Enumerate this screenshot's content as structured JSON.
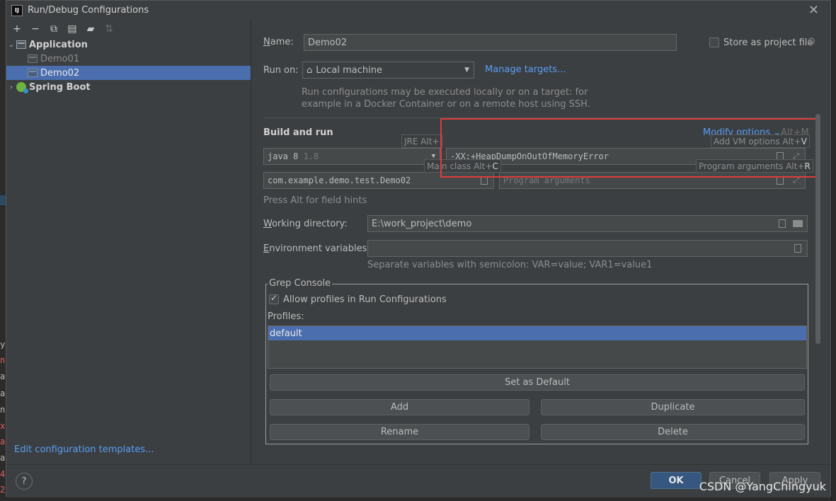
{
  "window": {
    "title": "Run/Debug Configurations",
    "app_icon_text": "IJ"
  },
  "toolbar": {
    "icons": [
      "add-icon",
      "remove-icon",
      "copy-icon",
      "save-icon",
      "new-folder-icon",
      "sort-icon"
    ]
  },
  "tree": {
    "application": {
      "label": "Application",
      "children": [
        "Demo01",
        "Demo02"
      ]
    },
    "spring_boot": {
      "label": "Spring Boot"
    }
  },
  "left": {
    "edit_templates": "Edit configuration templates..."
  },
  "form": {
    "name_label": "Name:",
    "name_value": "Demo02",
    "store_label": "Store as project file",
    "runon_label": "Run on:",
    "runon_value": "Local machine",
    "manage_targets": "Manage targets...",
    "runon_hint_1": "Run configurations may be executed locally or on a target: for",
    "runon_hint_2": "example in a Docker Container or on a remote host using SSH.",
    "build_run_title": "Build and run",
    "modify_options": "Modify options",
    "modify_shortcut": "Alt+M",
    "jre_value": "java 8",
    "jre_version": "1.8",
    "vm_options": "-XX:+HeapDumpOnOutOfMemoryError",
    "main_class": "com.example.demo.test.Demo02",
    "program_args_placeholder": "Program arguments",
    "alt_hint": "Press Alt for field hints",
    "workdir_label": "Working directory:",
    "workdir_value": "E:\\work_project\\demo",
    "env_label": "Environment variables:",
    "env_hint": "Separate variables with semicolon: VAR=value; VAR1=value1"
  },
  "hints": {
    "jre": {
      "text": "JRE Alt+",
      "key": ""
    },
    "vm": {
      "text": "Add VM options Alt+",
      "key": "V"
    },
    "main": {
      "text": "Main class Alt+",
      "key": "C"
    },
    "args": {
      "text": "Program arguments Alt+",
      "key": "R"
    }
  },
  "grep": {
    "legend": "Grep Console",
    "allow_profiles": "Allow profiles in Run Configurations",
    "profiles_label": "Profiles:",
    "profiles": [
      "default"
    ],
    "set_default": "Set as Default",
    "add": "Add",
    "duplicate": "Duplicate",
    "rename": "Rename",
    "delete": "Delete"
  },
  "footer": {
    "help": "?",
    "ok": "OK",
    "cancel": "Cancel",
    "apply": "Apply"
  },
  "watermark": "CSDN @YangChingyuk",
  "colors": {
    "selection": "#4b6eaf",
    "link": "#589df6",
    "highlight_box": "#e03b3b"
  }
}
